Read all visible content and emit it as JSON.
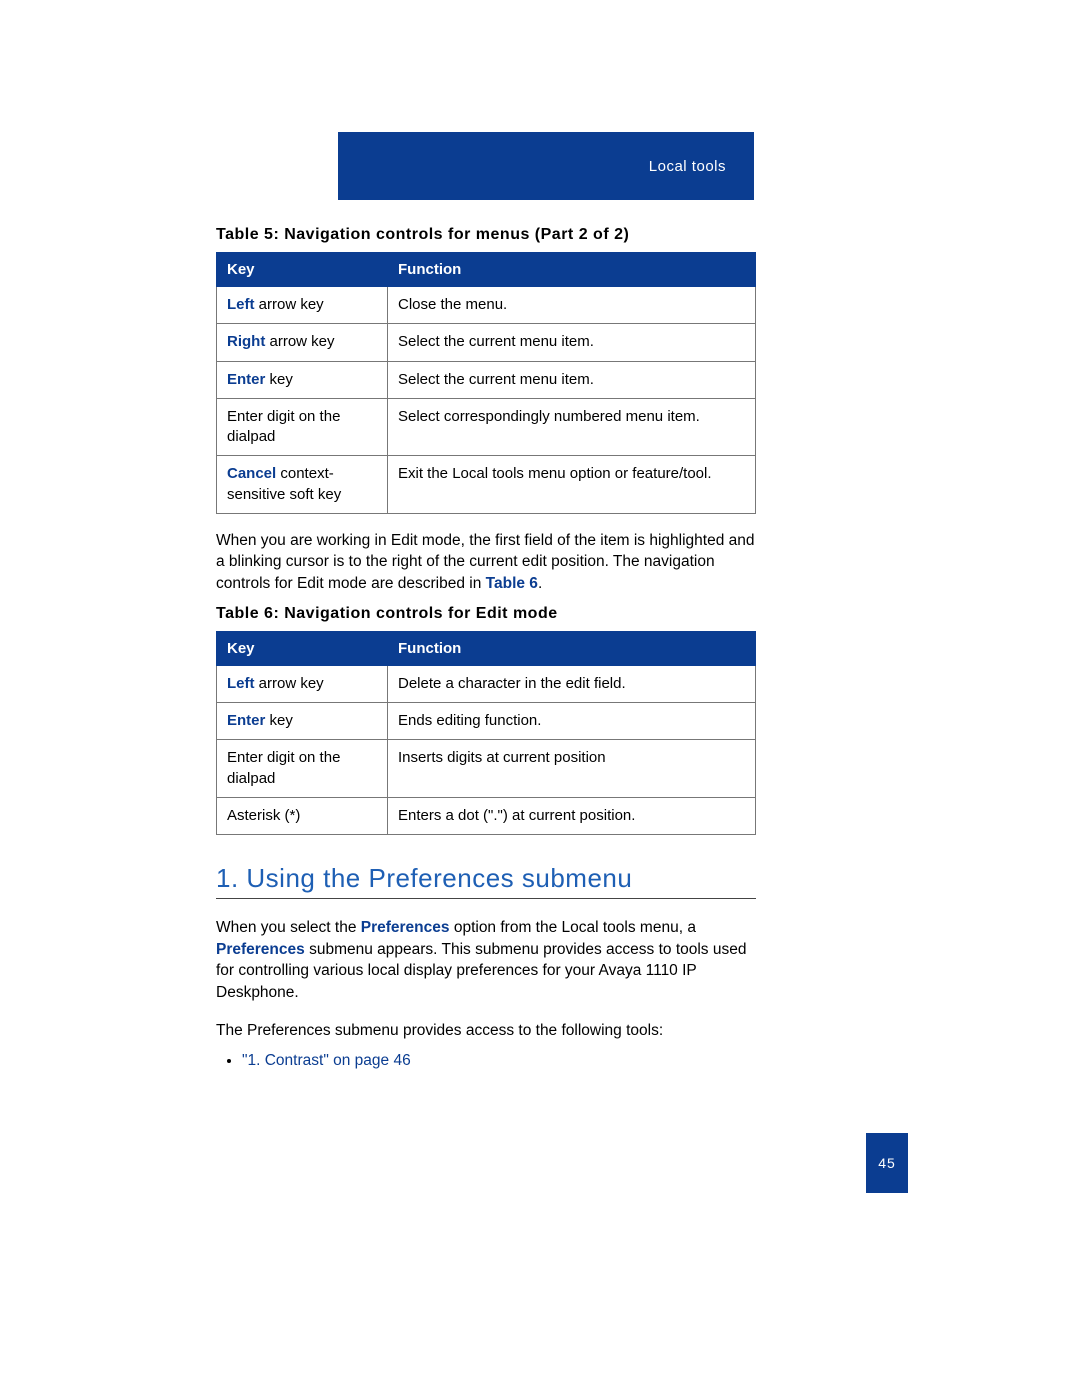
{
  "header": {
    "section_title": "Local tools"
  },
  "table5": {
    "caption_prefix": "Table 5: ",
    "caption_text": "Navigation controls for menus (Part 2 of 2)",
    "columns": {
      "key": "Key",
      "function": "Function"
    },
    "rows": [
      {
        "key_bold": "Left",
        "key_rest": " arrow key",
        "func": "Close the menu."
      },
      {
        "key_bold": "Right",
        "key_rest": " arrow key",
        "func": "Select the current menu item."
      },
      {
        "key_bold": "Enter",
        "key_rest": " key",
        "func": "Select the current menu item."
      },
      {
        "key_bold": "",
        "key_rest": "Enter digit on the dialpad",
        "func": "Select correspondingly numbered menu item."
      },
      {
        "key_bold": "Cancel",
        "key_rest": " context-sensitive soft key",
        "func": "Exit the Local tools menu option or feature/tool."
      }
    ]
  },
  "paragraph1": {
    "text_before": "When you are working in Edit mode, the first field of the item is highlighted and a blinking cursor is to the right of the current edit position. The navigation controls for Edit mode are described in ",
    "link": "Table 6",
    "text_after": "."
  },
  "table6": {
    "caption_prefix": "Table 6: ",
    "caption_text": "Navigation controls for Edit mode",
    "columns": {
      "key": "Key",
      "function": "Function"
    },
    "rows": [
      {
        "key_bold": "Left",
        "key_rest": " arrow key",
        "func": "Delete a character in the edit field."
      },
      {
        "key_bold": "Enter",
        "key_rest": " key",
        "func": "Ends editing function."
      },
      {
        "key_bold": "",
        "key_rest": "Enter digit on the dialpad",
        "func": "Inserts digits at current position"
      },
      {
        "key_bold": "",
        "key_rest": "Asterisk (*)",
        "func": "Enters a dot (\".\") at current position."
      }
    ]
  },
  "heading1": "1. Using the Preferences submenu",
  "paragraph2": {
    "seg1": "When you select the ",
    "bold1": "Preferences",
    "seg2": " option from the Local tools menu, a ",
    "bold2": "Preferences",
    "seg3": " submenu appears. This submenu provides access to tools used for controlling various local display preferences for your Avaya 1110 IP  Deskphone."
  },
  "paragraph3": "The Preferences submenu provides access to the following tools:",
  "bullets": [
    {
      "text": "\"1. Contrast\" on page 46"
    }
  ],
  "page_number": "45"
}
